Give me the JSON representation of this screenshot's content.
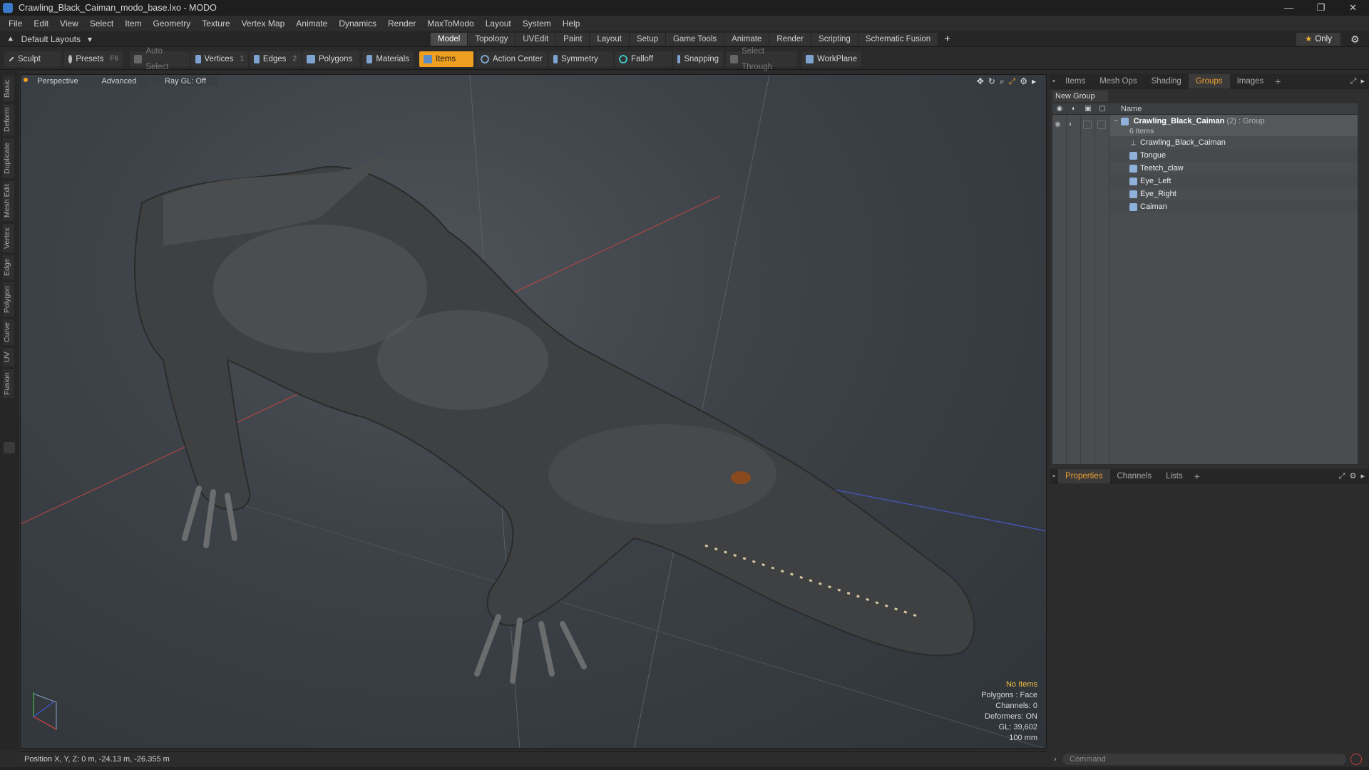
{
  "window": {
    "title": "Crawling_Black_Caiman_modo_base.lxo - MODO",
    "min_icon": "minimize-icon",
    "max_icon": "restore-icon",
    "close_icon": "close-icon",
    "min_glyph": "—",
    "max_glyph": "❐",
    "close_glyph": "✕"
  },
  "menu": [
    "File",
    "Edit",
    "View",
    "Select",
    "Item",
    "Geometry",
    "Texture",
    "Vertex Map",
    "Animate",
    "Dynamics",
    "Render",
    "MaxToModo",
    "Layout",
    "System",
    "Help"
  ],
  "layout_tabs": {
    "layouts_label": "Default Layouts",
    "tabs": [
      "Model",
      "Topology",
      "UVEdit",
      "Paint",
      "Layout",
      "Setup",
      "Game Tools",
      "Animate",
      "Render",
      "Scripting",
      "Schematic Fusion"
    ],
    "active_tab": "Model",
    "plus": "+",
    "only_label": "Only"
  },
  "toolbar": {
    "sculpt": "Sculpt",
    "presets": "Presets",
    "presets_key": "F6",
    "auto_select": "Auto Select",
    "vertices": "Vertices",
    "vertices_key": "1",
    "edges": "Edges",
    "edges_key": "2",
    "polygons": "Polygons",
    "materials": "Materials",
    "items": "Items",
    "action_center": "Action Center",
    "symmetry": "Symmetry",
    "falloff": "Falloff",
    "snapping": "Snapping",
    "select_through": "Select Through",
    "workplane": "WorkPlane"
  },
  "left_tabs": [
    "Basic",
    "Deform",
    "Duplicate",
    "Mesh Edit",
    "Vertex",
    "Edge",
    "Polygon",
    "Curve",
    "UV",
    "Fusion"
  ],
  "viewport": {
    "view": "Perspective",
    "shading": "Advanced",
    "raygl": "Ray GL: Off",
    "stats": {
      "items": "No Items",
      "polygons": "Polygons : Face",
      "channels": "Channels: 0",
      "deformers": "Deformers: ON",
      "gl": "GL: 39,602",
      "scale": "100 mm"
    }
  },
  "groups_panel": {
    "tabs": [
      "Items",
      "Mesh Ops",
      "Shading",
      "Groups",
      "Images"
    ],
    "active_tab": "Groups",
    "new_group": "New Group",
    "name_header": "Name",
    "group": {
      "name": "Crawling_Black_Caiman",
      "count": "(2)",
      "type": ": Group",
      "items_count": "6 Items"
    },
    "children": [
      "Crawling_Black_Caiman",
      "Tongue",
      "Teetch_claw",
      "Eye_Left",
      "Eye_Right",
      "Caiman"
    ]
  },
  "properties_panel": {
    "tabs": [
      "Properties",
      "Channels",
      "Lists"
    ],
    "active_tab": "Properties"
  },
  "status": {
    "position": "Position X, Y, Z:  0 m, -24.13 m, -26.355 m"
  },
  "command": {
    "placeholder": "Command"
  },
  "colors": {
    "accent": "#f0a020",
    "viewport_bg": "#3c4247",
    "axis_x": "#c04040",
    "axis_z": "#4050c0"
  }
}
